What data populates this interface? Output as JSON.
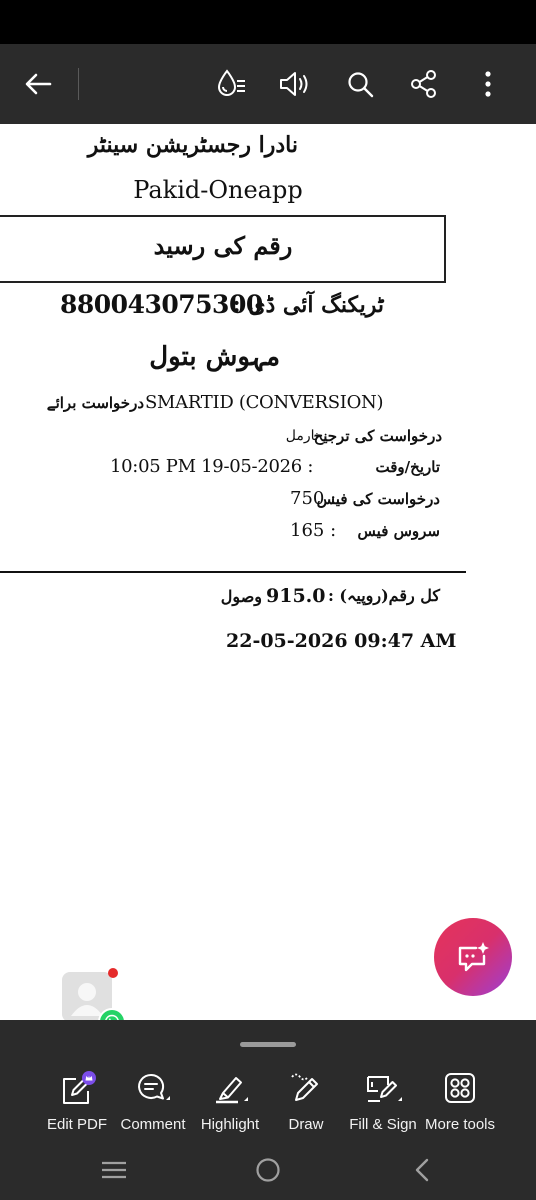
{
  "app_toolbar": {
    "icons": [
      "back-arrow-icon",
      "reading-mode-icon",
      "read-aloud-icon",
      "search-icon",
      "share-icon",
      "more-options-icon"
    ]
  },
  "document": {
    "center_name": "نادرا رجسٹریشن سینٹر",
    "app_name": "Pakid-Oneapp",
    "receipt_title": "رقم کی رسید",
    "tracking_label": "ٹریکنگ آئی ڈی :",
    "tracking_id": "880043075300",
    "applicant_name": "مہوش بتول",
    "request_for_label": "درخواست برائے",
    "request_for_value": "SMARTID (CONVERSION)",
    "priority_label": "درخواست کی ترجیح",
    "priority_value": ": نارمل",
    "datetime_label": "تاریخ/وقت",
    "datetime_value": "10:05 PM 19-05-2026 :",
    "app_fee_label": "درخواست کی فیس",
    "app_fee_value": "750 :",
    "service_fee_label": "سروس فیس",
    "service_fee_value": "165 :",
    "total_label": "کل رقم(روپیہ) :",
    "total_value": "915.0",
    "received_label": "وصول",
    "receipt_datetime": "22-05-2026 09:47 AM"
  },
  "bottom_tools": [
    {
      "label": "Edit PDF",
      "icon": "edit-pdf-icon"
    },
    {
      "label": "Comment",
      "icon": "comment-icon"
    },
    {
      "label": "Highlight",
      "icon": "highlight-icon"
    },
    {
      "label": "Draw",
      "icon": "draw-icon"
    },
    {
      "label": "Fill & Sign",
      "icon": "fill-sign-icon"
    },
    {
      "label": "More tools",
      "icon": "more-tools-icon"
    }
  ],
  "colors": {
    "toolbar_bg": "#2b2b2b",
    "fab_gradient_start": "#e5345a",
    "fab_gradient_end": "#9c3fd6",
    "premium_badge": "#7b4de8",
    "whatsapp_green": "#25d366"
  },
  "navbar": {
    "icons": [
      "recent-apps-icon",
      "home-icon",
      "back-icon"
    ]
  }
}
